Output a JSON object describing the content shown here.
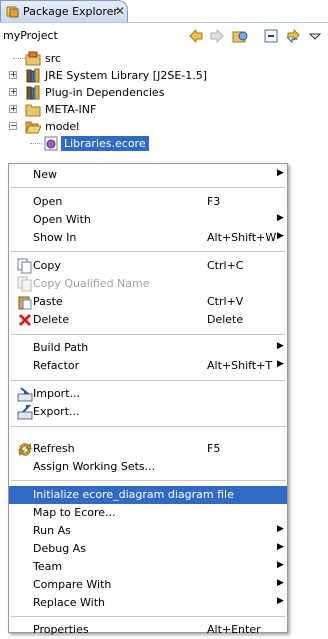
{
  "view": {
    "tab_title": "Package Explorer",
    "project_title": "myProject",
    "colors": {
      "accent": "#316ac5",
      "tab_bg": "#c9d9ef",
      "border": "#7f9db9"
    }
  },
  "tree": {
    "items": [
      {
        "label": "src",
        "icon": "source-folder-icon"
      },
      {
        "label": "JRE System Library [J2SE-1.5]",
        "icon": "library-icon"
      },
      {
        "label": "Plug-in Dependencies",
        "icon": "library-icon"
      },
      {
        "label": "META-INF",
        "icon": "folder-icon"
      },
      {
        "label": "model",
        "icon": "folder-open-icon"
      },
      {
        "label": "Libraries.ecore",
        "icon": "ecore-file-icon",
        "selected": true
      }
    ]
  },
  "menu": {
    "items": [
      {
        "label": "New",
        "submenu": true
      },
      {
        "label": "Open",
        "accel": "F3"
      },
      {
        "label": "Open With",
        "submenu": true
      },
      {
        "label": "Show In",
        "accel": "Alt+Shift+W",
        "submenu": true
      },
      {
        "label": "Copy",
        "accel": "Ctrl+C",
        "icon": "copy-icon"
      },
      {
        "label": "Copy Qualified Name",
        "icon": "copy-icon",
        "disabled": true
      },
      {
        "label": "Paste",
        "accel": "Ctrl+V",
        "icon": "paste-icon"
      },
      {
        "label": "Delete",
        "accel": "Delete",
        "icon": "delete-icon"
      },
      {
        "label": "Build Path",
        "submenu": true
      },
      {
        "label": "Refactor",
        "accel": "Alt+Shift+T",
        "submenu": true
      },
      {
        "label": "Import...",
        "icon": "import-icon"
      },
      {
        "label": "Export...",
        "icon": "export-icon"
      },
      {
        "label": "Refresh",
        "accel": "F5",
        "icon": "refresh-icon"
      },
      {
        "label": "Assign Working Sets..."
      },
      {
        "label": "Initialize ecore_diagram diagram file",
        "highlighted": true
      },
      {
        "label": "Map to Ecore..."
      },
      {
        "label": "Run As",
        "submenu": true
      },
      {
        "label": "Debug As",
        "submenu": true
      },
      {
        "label": "Team",
        "submenu": true
      },
      {
        "label": "Compare With",
        "submenu": true
      },
      {
        "label": "Replace With",
        "submenu": true
      },
      {
        "label": "Properties",
        "accel": "Alt+Enter"
      }
    ],
    "submenu_arrow": "▶"
  }
}
